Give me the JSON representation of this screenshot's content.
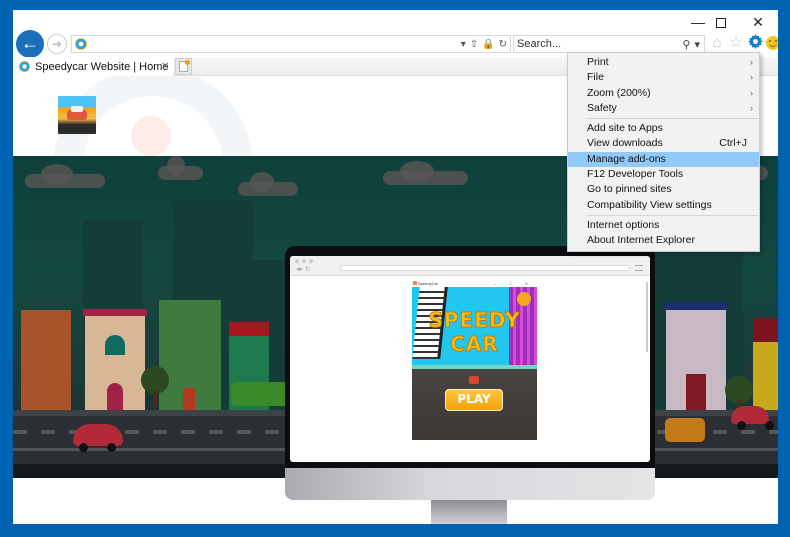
{
  "window": {
    "controls": {
      "minimize": "—",
      "maximize": "",
      "close": "✕"
    }
  },
  "nav": {
    "back_icon": "←",
    "forward_icon": "➜",
    "address": {
      "value": "",
      "placeholder": ""
    },
    "address_tools": {
      "dropdown": "▾",
      "share": "⇧",
      "lock": "🔒",
      "refresh": "↻"
    },
    "search": {
      "value": "",
      "placeholder": "Search..."
    },
    "search_tools": {
      "search_icon": "⚲",
      "dropdown": "▾"
    },
    "command_icons": {
      "home": "⌂",
      "favorites": "☆",
      "tools": "✿",
      "feedback": ""
    }
  },
  "tab": {
    "title": "Speedycar Website | Home",
    "close": "✕"
  },
  "monitor": {
    "browser_nav": "◂▸ ↻",
    "game": {
      "window_title": "SpeedyCar",
      "window_controls": "– □ ✕",
      "title_line1": "SPEEDY",
      "title_line2": "CAR",
      "play_label": "PLAY"
    }
  },
  "menu": {
    "groups": [
      [
        {
          "label": "Print",
          "submenu": true
        },
        {
          "label": "File",
          "submenu": true
        },
        {
          "label": "Zoom (200%)",
          "submenu": true
        },
        {
          "label": "Safety",
          "submenu": true
        }
      ],
      [
        {
          "label": "Add site to Apps"
        },
        {
          "label": "View downloads",
          "shortcut": "Ctrl+J"
        },
        {
          "label": "Manage add-ons",
          "highlighted": true
        },
        {
          "label": "F12 Developer Tools"
        },
        {
          "label": "Go to pinned sites"
        },
        {
          "label": "Compatibility View settings"
        }
      ],
      [
        {
          "label": "Internet options"
        },
        {
          "label": "About Internet Explorer"
        }
      ]
    ],
    "submenu_arrow": "›"
  },
  "colors": {
    "frame": "#0063b1",
    "accent": "#1b6fb8",
    "menu_highlight": "#91c9f7",
    "banner": "#12493f"
  }
}
